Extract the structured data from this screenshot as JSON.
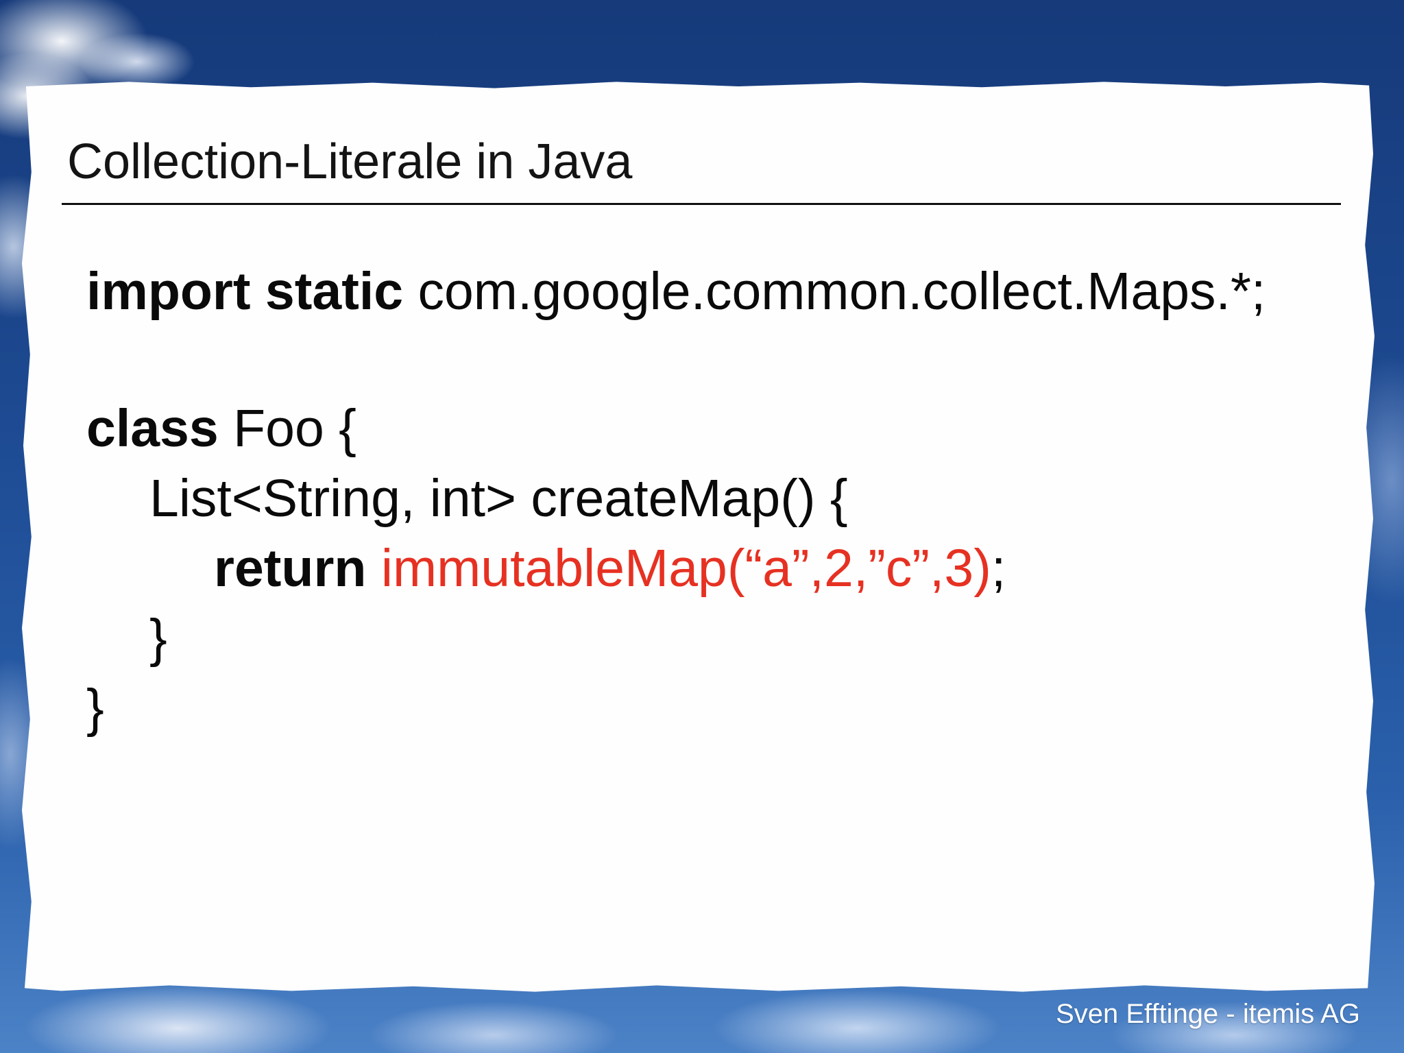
{
  "slide": {
    "title": "Collection-Literale in Java",
    "code": {
      "line1_keyword": "import static",
      "line1_rest": "com.google.common.collect.Maps.*;",
      "line3_keyword": "class",
      "line3_rest": "Foo {",
      "line4": "List<String, int> createMap() {",
      "line5_keyword": "return",
      "line5_call": "immutableMap(“a”,2,”c”,3)",
      "line5_end": ";",
      "line6": "}",
      "line7": "}"
    },
    "footer": "Sven Efftinge - itemis AG"
  },
  "colors": {
    "highlight": "#e63122",
    "sky": "#1d4a92",
    "paper": "#fefefe"
  }
}
